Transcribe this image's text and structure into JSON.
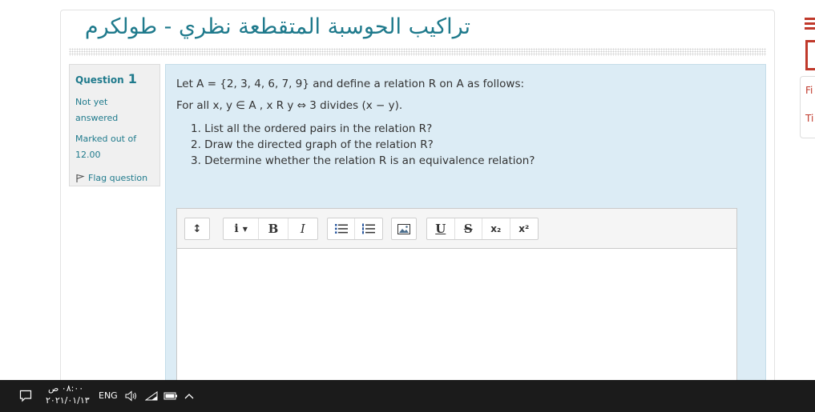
{
  "page": {
    "title": "تراكيب الحوسبة المتقطعة نظري - طولكرم"
  },
  "question_info": {
    "label": "Question",
    "number": "1",
    "status_line1": "Not yet",
    "status_line2": "answered",
    "marks_line1": "Marked out of",
    "marks_line2": "12.00",
    "flag_label": "Flag question"
  },
  "question": {
    "line1": "Let A = {2, 3, 4, 6, 7, 9} and define a relation R on A as follows:",
    "line2": "For all x, y ∈ A , x R y ⇔ 3  divides (x − y).",
    "items": [
      "List all the ordered pairs in the relation R?",
      "Draw the directed graph of the relation R?",
      "Determine whether the relation R is an equivalence relation?"
    ]
  },
  "toolbar": {
    "collapse_glyph": "↕",
    "info_glyph": "i",
    "bold_glyph": "B",
    "italic_glyph": "I",
    "underline_glyph": "U",
    "strike_glyph": "S",
    "subscript_glyph": "x₂",
    "superscript_glyph": "x²"
  },
  "sidebar": {
    "text1": "Fi",
    "text2": "Ti"
  },
  "taskbar": {
    "time": "٠٨:٠٠ ص",
    "date": "٢٠٢١/٠١/١٣",
    "language": "ENG"
  },
  "colors": {
    "title": "#1f7a8c",
    "content_bg": "#dcecf5",
    "accent_red": "#c0392b",
    "taskbar_bg": "#1b1b1b"
  }
}
